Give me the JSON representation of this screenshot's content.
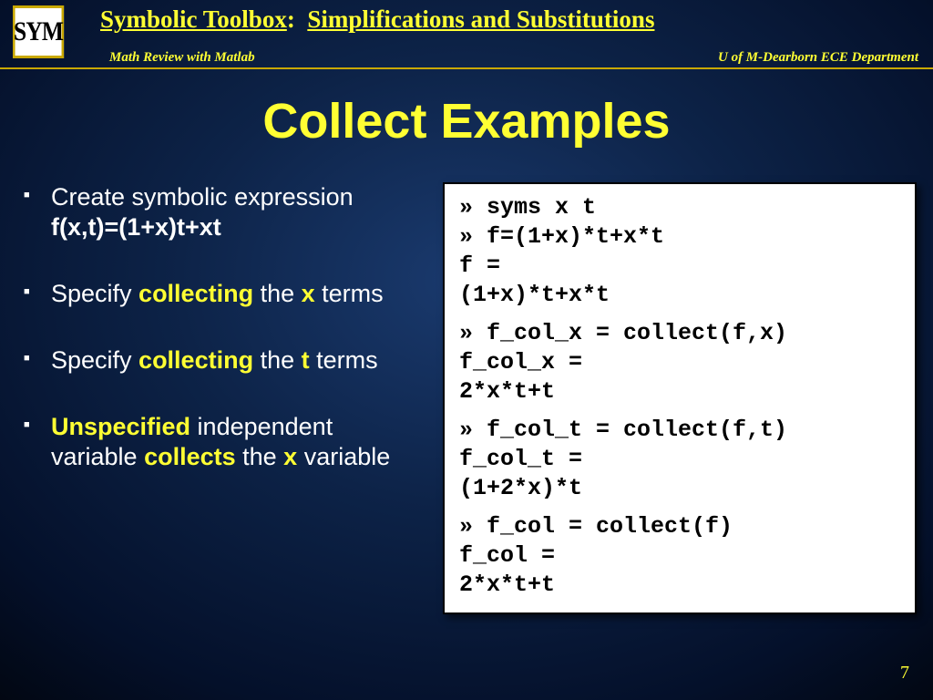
{
  "header": {
    "logo": "SYM",
    "toolbox": "Symbolic Toolbox",
    "colon": ":",
    "section": "Simplifications and Substitutions",
    "subleft": "Math Review with Matlab",
    "subright": "U of M-Dearborn ECE Department"
  },
  "title": "Collect Examples",
  "bullets": [
    {
      "pre": "Create symbolic expression ",
      "bold": "f(x,t)=(1+x)t+xt"
    },
    {
      "pre": "Specify ",
      "y1": "collecting",
      "mid": " the ",
      "y2": "x",
      "post": " terms"
    },
    {
      "pre": "Specify ",
      "y1": "collecting",
      "mid": " the ",
      "y2": "t",
      "post": " terms"
    },
    {
      "y0": "Unspecified",
      "mid1": " independent variable ",
      "y1": "collects",
      "mid2": " the ",
      "y2": "x",
      "post": " variable"
    }
  ],
  "code": {
    "b1": {
      "l1": "» syms x t",
      "l2": "» f=(1+x)*t+x*t",
      "l3": "f =",
      "l4": "(1+x)*t+x*t"
    },
    "b2": {
      "l1": "» f_col_x = collect(f,x)",
      "l2": "f_col_x =",
      "l3": "2*x*t+t"
    },
    "b3": {
      "l1": "» f_col_t = collect(f,t)",
      "l2": "f_col_t =",
      "l3": "(1+2*x)*t"
    },
    "b4": {
      "l1": "» f_col = collect(f)",
      "l2": "f_col =",
      "l3": "2*x*t+t"
    }
  },
  "pagenum": "7"
}
